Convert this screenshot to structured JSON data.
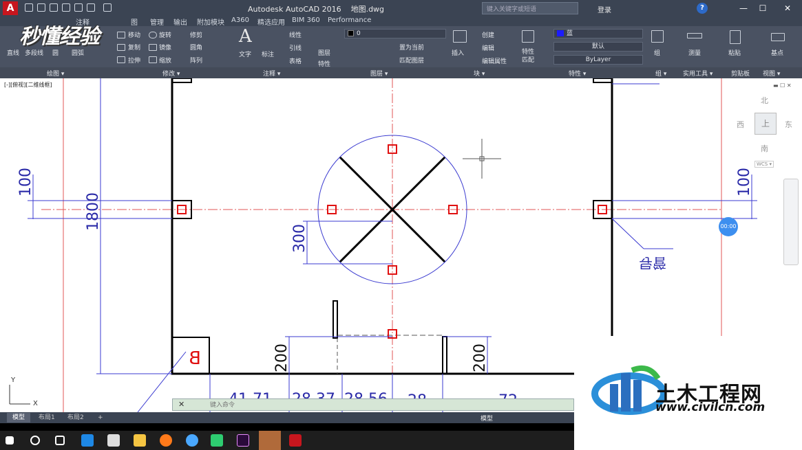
{
  "titlebar": {
    "app_logo": "A",
    "title": "Autodesk AutoCAD 2016    地图.dwg",
    "search_placeholder": "键入关键字或短语",
    "signin": "登录",
    "help": "?",
    "minimize": "—",
    "maximize": "☐",
    "close": "✕"
  },
  "watermark": "秒懂经验",
  "ribbon_tabs": [
    "注释",
    "图",
    "管理",
    "输出",
    "附加模块",
    "A360",
    "精选应用",
    "BIM 360",
    "Performance"
  ],
  "ribbon": {
    "draw": {
      "items": [
        "直线",
        "多段线",
        "圆",
        "圆弧"
      ],
      "title": "绘图 ▾"
    },
    "modify": {
      "items": [
        "移动",
        "旋转",
        "修剪",
        "复制",
        "镜像",
        "圆角",
        "拉伸",
        "缩放",
        "阵列"
      ],
      "title": "修改 ▾"
    },
    "annotation": {
      "text": "文字",
      "dimension": "标注",
      "items": [
        "线性",
        "引线",
        "表格"
      ],
      "title": "注释 ▾"
    },
    "layers": {
      "layer_props": "图层特性",
      "layer_value": "0",
      "set_current": "置为当前",
      "match_layer": "匹配图层",
      "title": "图层 ▾"
    },
    "block": {
      "insert": "插入",
      "create": "创建",
      "edit": "编辑",
      "edit_attr": "编辑属性",
      "title": "块 ▾"
    },
    "properties": {
      "match": "特性匹配",
      "color": "蓝",
      "linetype": "默认",
      "lineweight": "ByLayer",
      "title": "特性 ▾"
    },
    "groups": {
      "group": "组",
      "title": "组 ▾"
    },
    "utilities": {
      "measure": "测量",
      "title": "实用工具 ▾"
    },
    "clipboard": {
      "paste": "粘贴",
      "title": "剪贴板"
    },
    "view": {
      "base": "基点",
      "title": "视图 ▾"
    }
  },
  "canvas": {
    "viewport_label": "[-][俯视][二维线框]",
    "viewcube": {
      "north": "北",
      "south": "南",
      "east": "东",
      "west": "西",
      "face": "上",
      "wcs": "WCS ▾"
    },
    "timer": "00:00",
    "dimensions": {
      "left_100": "100",
      "left_1800": "1800",
      "right_100": "100",
      "radius_300": "300",
      "bottom_left_200": "200",
      "bottom_right_200": "200",
      "d1": "41,71",
      "d2": "28,37",
      "d3": "28,56",
      "d4": "28",
      "d5": "72"
    },
    "label_b": "B",
    "leader_text": "导管",
    "ucs_y": "Y",
    "ucs_x": "X"
  },
  "cmdline": {
    "close": "✕",
    "placeholder": "键入命令"
  },
  "layout_tabs": [
    "模型",
    "布局1",
    "布局2",
    "+"
  ],
  "status": {
    "model": "模型"
  },
  "site": {
    "name": "土木工程网",
    "url": "www.civilcn.com"
  }
}
